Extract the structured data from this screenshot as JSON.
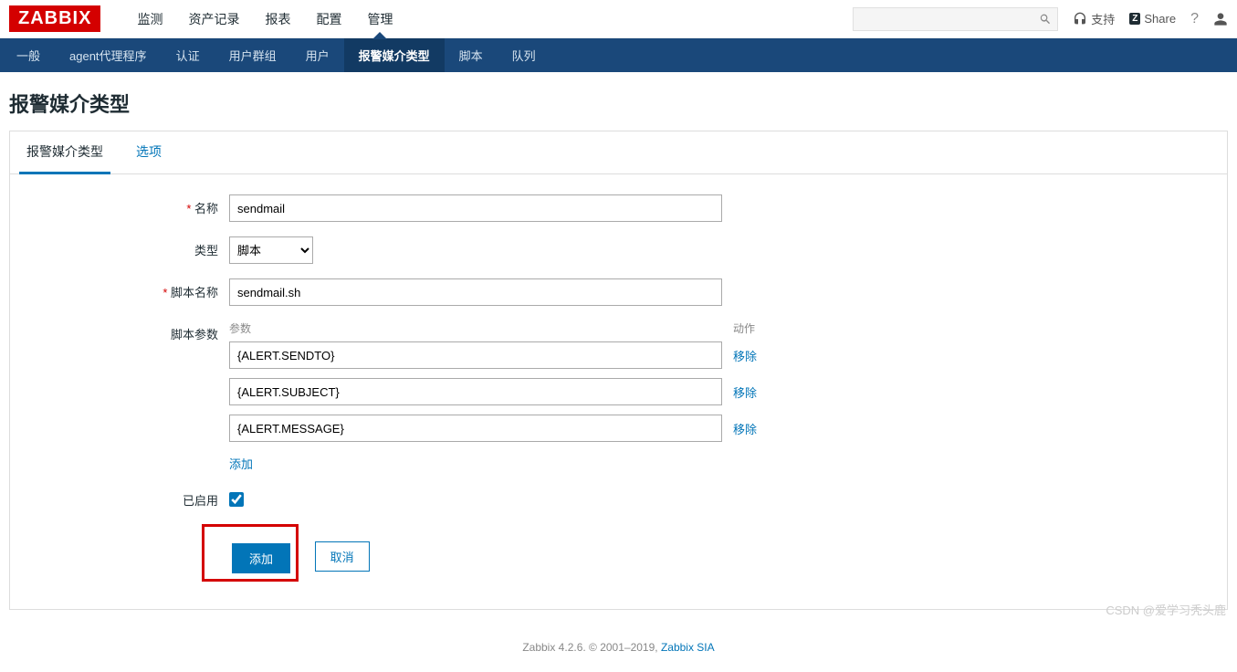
{
  "logo": "ZABBIX",
  "topnav": [
    "监测",
    "资产记录",
    "报表",
    "配置",
    "管理"
  ],
  "topnav_active": 4,
  "top_right": {
    "support": "支持",
    "share": "Share",
    "help_icon": "?",
    "user_icon": "user"
  },
  "subnav": [
    "一般",
    "agent代理程序",
    "认证",
    "用户群组",
    "用户",
    "报警媒介类型",
    "脚本",
    "队列"
  ],
  "subnav_active": 5,
  "page_title": "报警媒介类型",
  "tabs": {
    "t1": "报警媒介类型",
    "t2": "选项",
    "active": 0
  },
  "form": {
    "name_label": "名称",
    "name_value": "sendmail",
    "type_label": "类型",
    "type_value": "脚本",
    "script_name_label": "脚本名称",
    "script_name_value": "sendmail.sh",
    "params_label": "脚本参数",
    "params_col1": "参数",
    "params_col2": "动作",
    "params": [
      {
        "value": "{ALERT.SENDTO}",
        "remove": "移除"
      },
      {
        "value": "{ALERT.SUBJECT}",
        "remove": "移除"
      },
      {
        "value": "{ALERT.MESSAGE}",
        "remove": "移除"
      }
    ],
    "add_param": "添加",
    "enabled_label": "已启用",
    "enabled": true,
    "submit": "添加",
    "cancel": "取消"
  },
  "footer": {
    "text": "Zabbix 4.2.6. © 2001–2019, ",
    "link": "Zabbix SIA"
  },
  "watermark": "CSDN @爱学习秃头鹿"
}
